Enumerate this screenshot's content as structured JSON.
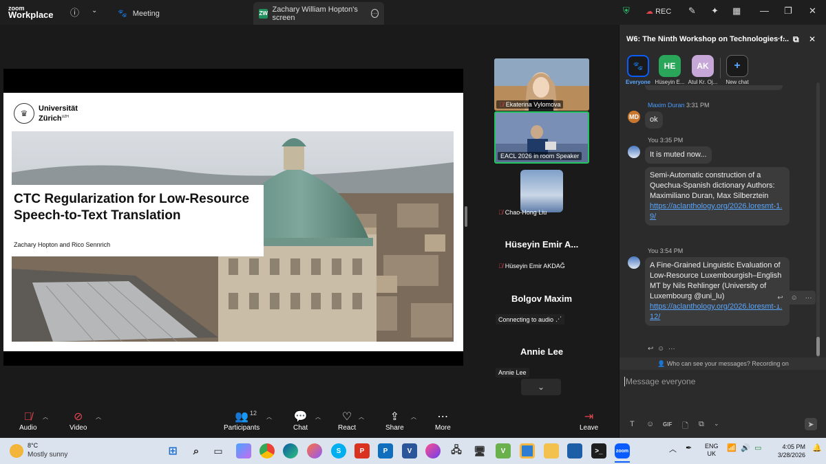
{
  "titlebar": {
    "logo_top": "zoom",
    "logo_bottom": "Workplace",
    "meeting_tab": "Meeting",
    "screen_tab": "Zachary William Hopton's screen",
    "screen_badge": "ZW",
    "rec": "REC"
  },
  "slide": {
    "university_line1": "Universität",
    "university_line2": "Zürich",
    "university_sup": "UZH",
    "title": "CTC Regularization for Low-Resource Speech-to-Text Translation",
    "authors": "Zachary Hopton and Rico Sennrich"
  },
  "participants": [
    {
      "name": "Ekaterina Vylomova"
    },
    {
      "name": "EACL 2026 in room Speaker"
    },
    {
      "name": "Chao-Hong Liu"
    },
    {
      "big": "Hüseyin  Emir  A...",
      "name": "Hüseyin Emir AKDAĞ"
    },
    {
      "big": "Bolgov Maxim",
      "name": "Connecting to audio"
    },
    {
      "big": "Annie Lee",
      "name": "Annie Lee"
    }
  ],
  "toolbar": {
    "audio": "Audio",
    "video": "Video",
    "participants": "Participants",
    "participants_count": "12",
    "chat": "Chat",
    "react": "React",
    "share": "Share",
    "more": "More",
    "leave": "Leave"
  },
  "chat": {
    "title": "W6: The Ninth Workshop on Technologies f...",
    "recipients": [
      {
        "label": "Everyone",
        "initials": "",
        "color": "#1a1a1a"
      },
      {
        "label": "Hüseyin E...",
        "initials": "HE",
        "color": "#2aa65a"
      },
      {
        "label": "Atul Kr. Oj...",
        "initials": "AK",
        "color": "#c7a6d8"
      },
      {
        "label": "New chat",
        "initials": "+",
        "color": "#1a1a1a"
      }
    ],
    "messages": [
      {
        "sender": "Maxim Duran",
        "time": "3:31 PM",
        "avatar": "MD",
        "text": "ok"
      },
      {
        "sender": "You",
        "time": "3:35 PM",
        "text": "It is muted now..."
      },
      {
        "text": "Semi-Automatic construction of a Quechua-Spanish dictionary Authors: Maximiliano Duran, Max Silberztein",
        "link": "https://aclanthology.org/2026.loresmt-1.9/"
      },
      {
        "sender": "You",
        "time": "3:54 PM",
        "text": "A Fine-Grained Linguistic Evaluation of Low-Resource Luxembourgish–English MT by Nils Rehlinger  (University of Luxembourg @uni_lu)",
        "link": "https://aclanthology.org/2026.loresmt-1.12/"
      }
    ],
    "who_can_see": "Who can see your messages? Recording on",
    "placeholder": "Message everyone",
    "gif": "GIF"
  },
  "taskbar": {
    "temp": "8°C",
    "weather": "Mostly sunny",
    "lang1": "ENG",
    "lang2": "UK",
    "time": "4:05 PM",
    "date": "3/28/2026",
    "zoom_label": "zoom"
  },
  "colors": {
    "accent": "#0b5cff",
    "active_speaker": "#22c55e",
    "leave": "#e0464f"
  }
}
